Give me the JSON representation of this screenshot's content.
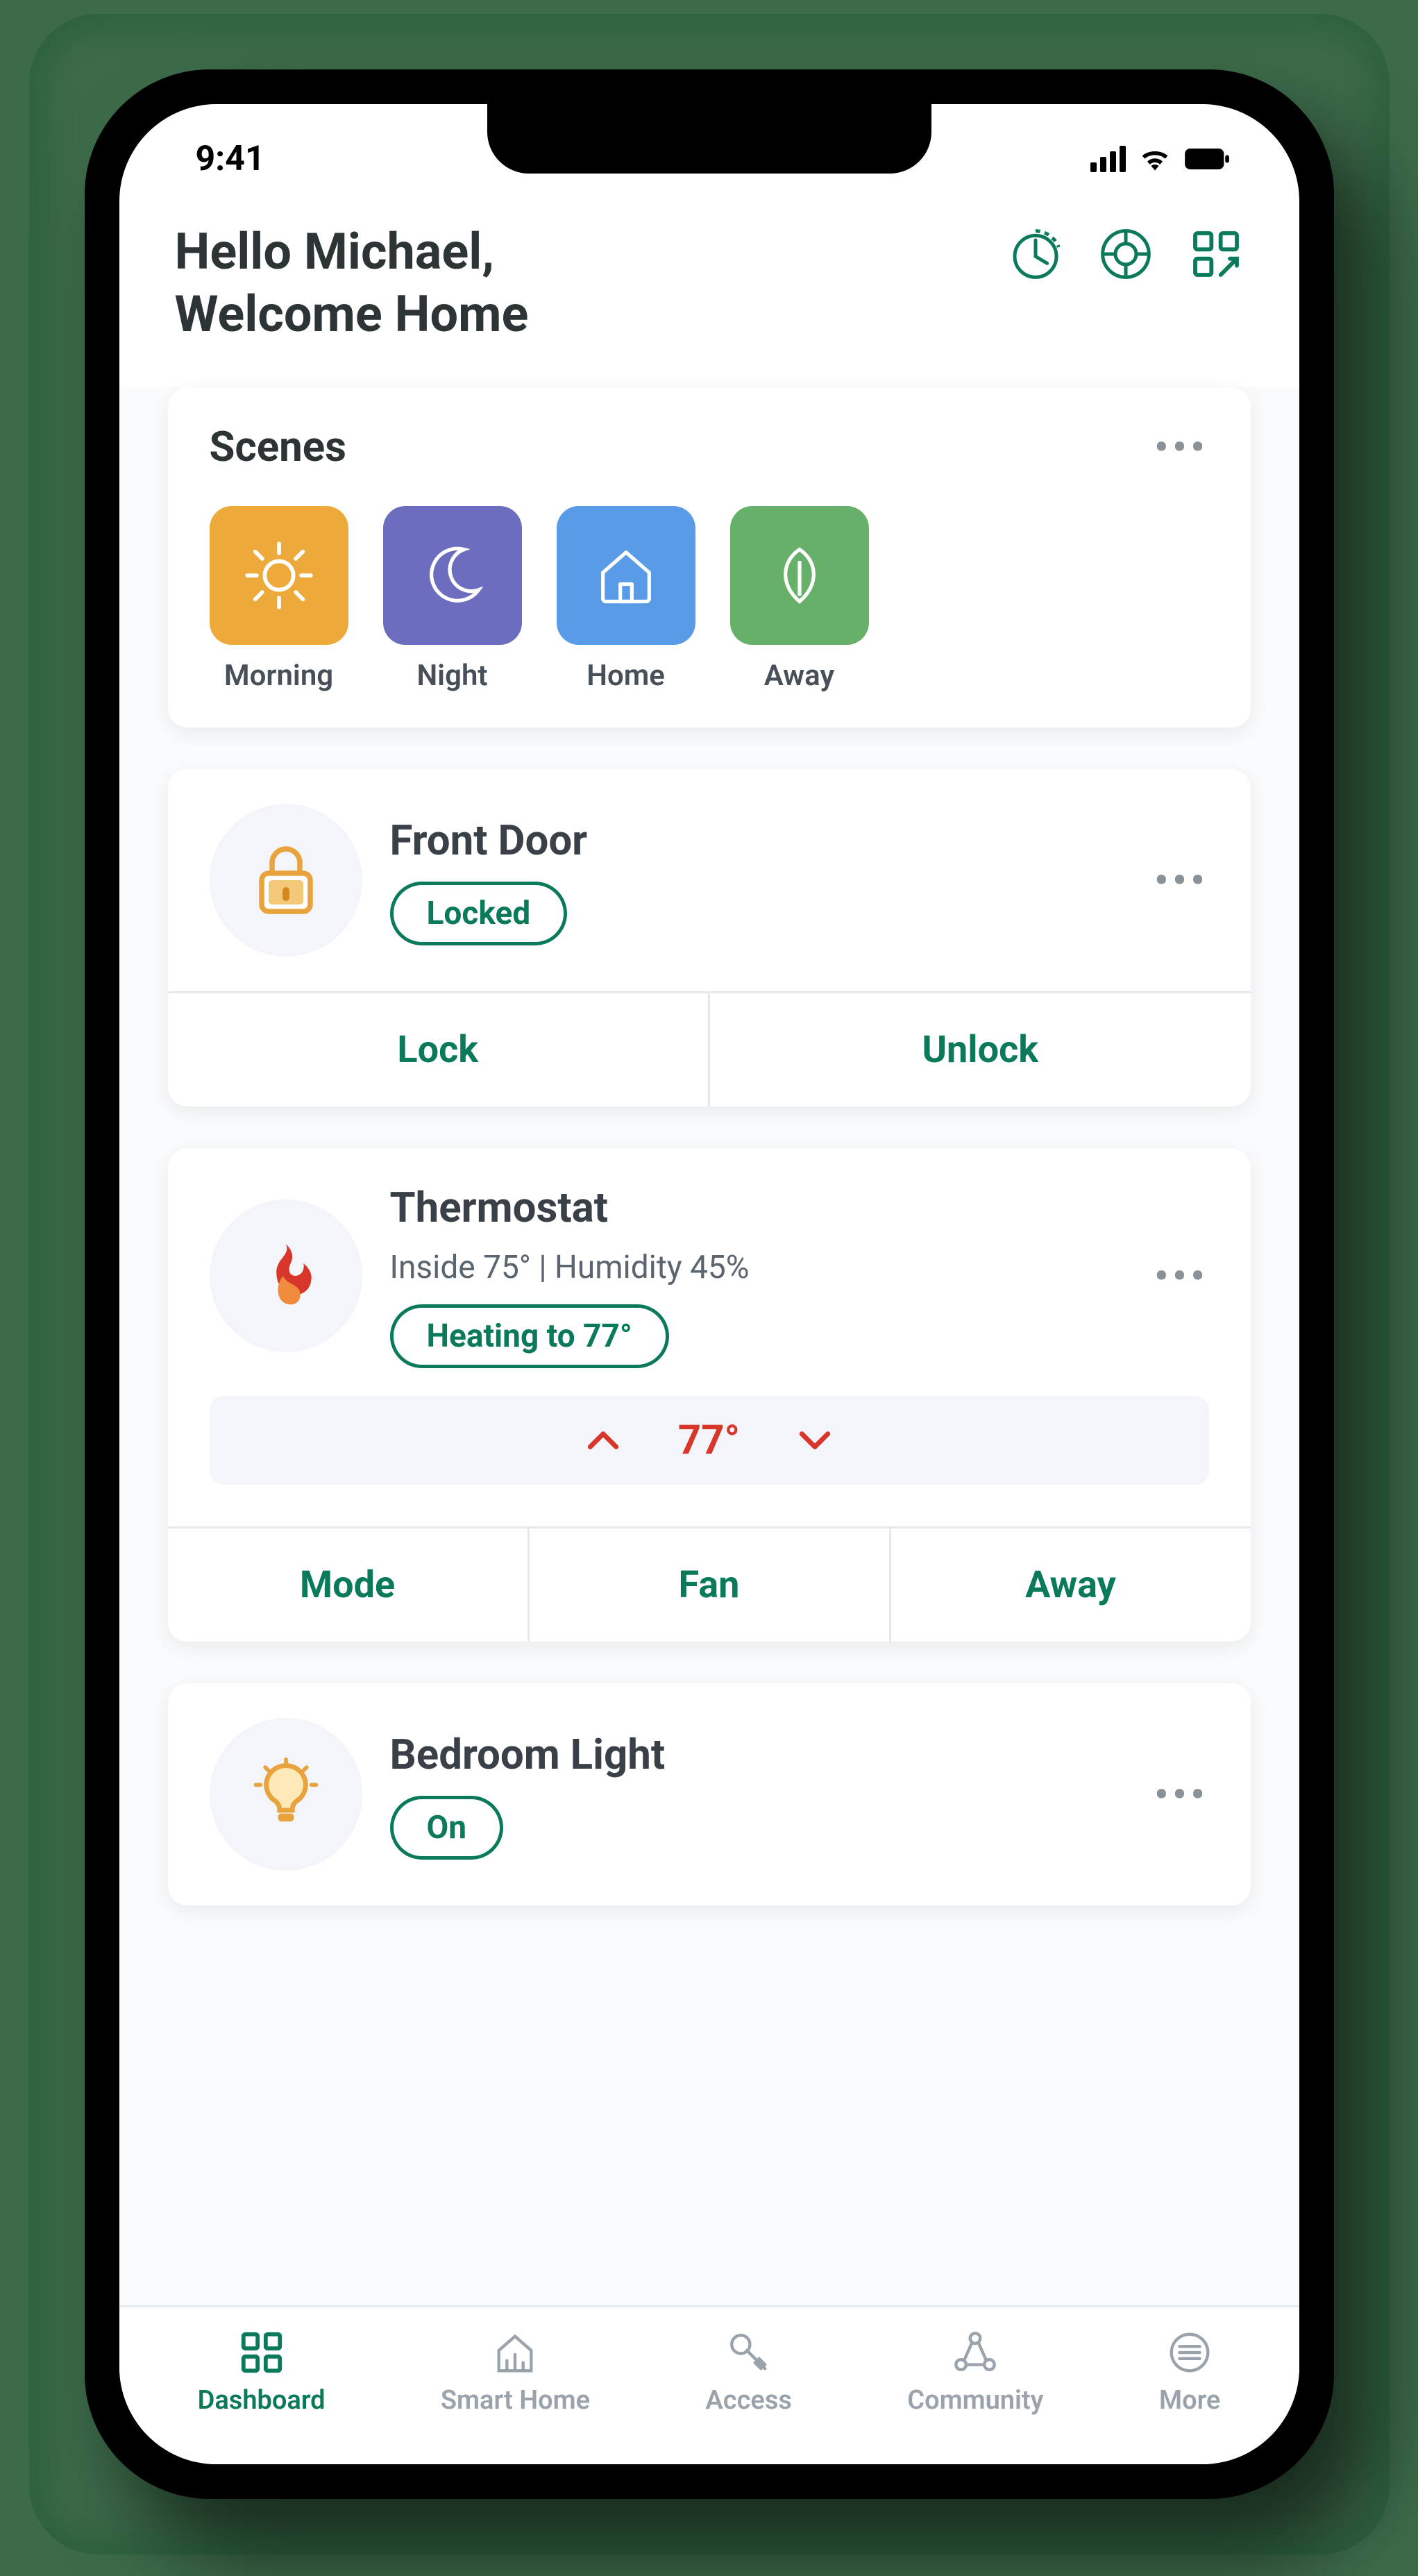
{
  "statusBar": {
    "time": "9:41"
  },
  "header": {
    "greetingLine1": "Hello Michael,",
    "greetingLine2": "Welcome Home"
  },
  "scenesCard": {
    "title": "Scenes",
    "scenes": [
      {
        "label": "Morning"
      },
      {
        "label": "Night"
      },
      {
        "label": "Home"
      },
      {
        "label": "Away"
      }
    ]
  },
  "frontDoor": {
    "title": "Front Door",
    "status": "Locked",
    "actions": {
      "lock": "Lock",
      "unlock": "Unlock"
    }
  },
  "thermostat": {
    "title": "Thermostat",
    "subtext": "Inside 75° | Humidity 45%",
    "status": "Heating to 77°",
    "setpoint": "77°",
    "actions": {
      "mode": "Mode",
      "fan": "Fan",
      "away": "Away"
    }
  },
  "bedroomLight": {
    "title": "Bedroom Light",
    "status": "On"
  },
  "nav": {
    "dashboard": "Dashboard",
    "smartHome": "Smart Home",
    "access": "Access",
    "community": "Community",
    "more": "More"
  }
}
